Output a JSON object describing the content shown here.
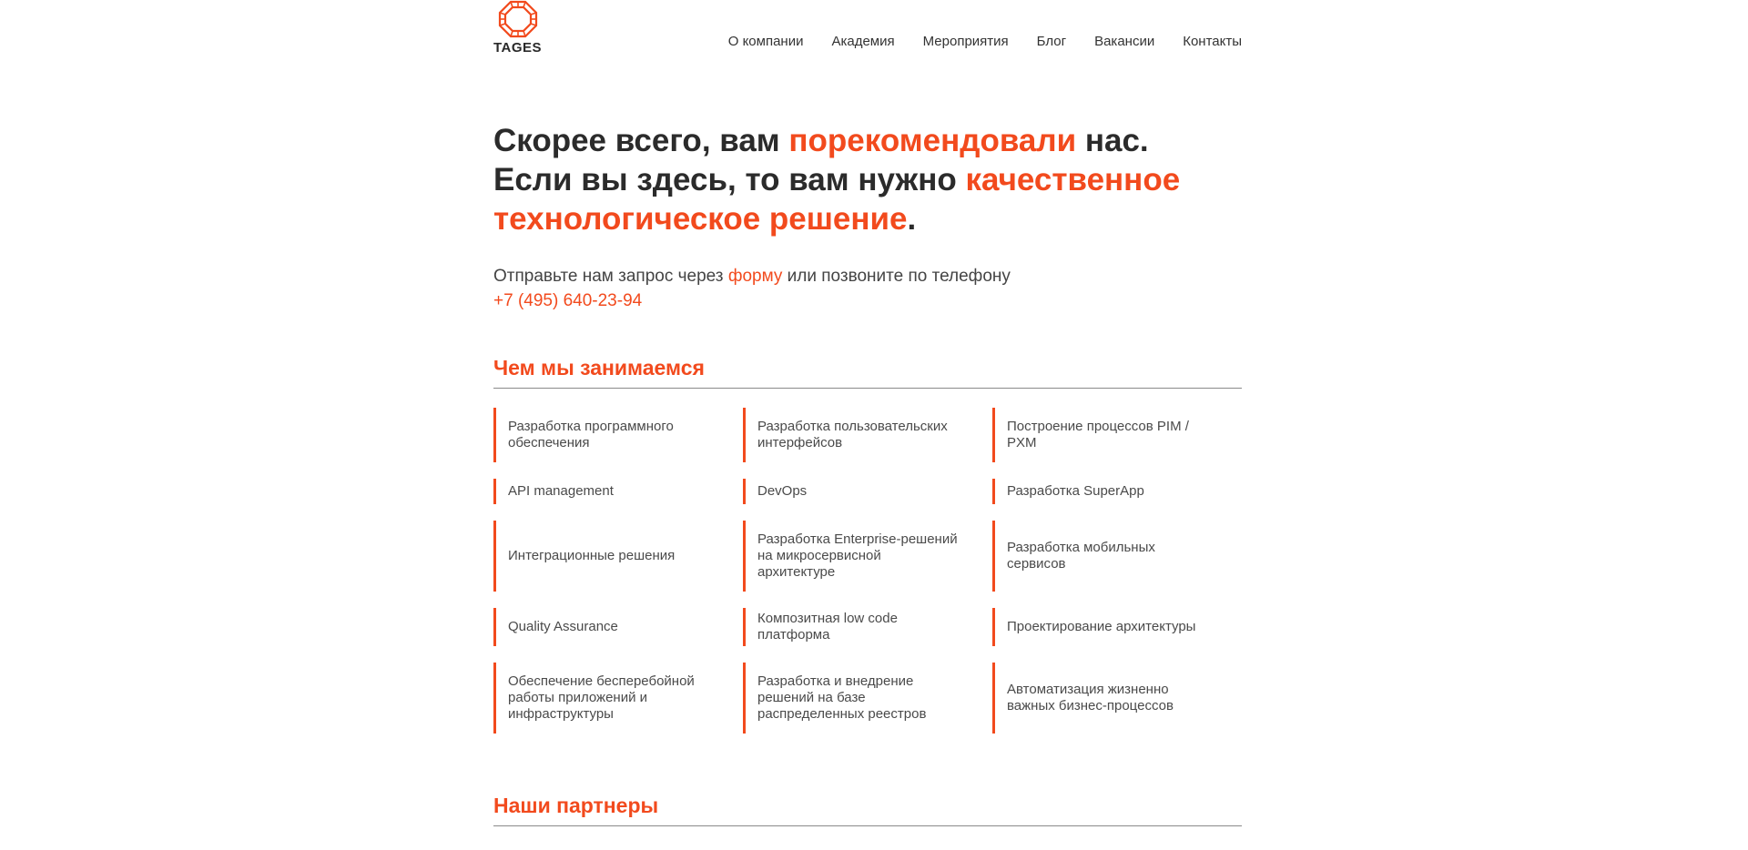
{
  "header": {
    "logo_text": "TAGES",
    "nav": [
      "О компании",
      "Академия",
      "Мероприятия",
      "Блог",
      "Вакансии",
      "Контакты"
    ]
  },
  "hero": {
    "line1_a": "Скорее всего, вам ",
    "line1_accent": "порекомендовали",
    "line1_b": " нас.",
    "line2_a": "Если вы здесь, то вам нужно ",
    "line2_accent": "качественное технологическое решение",
    "line2_b": "."
  },
  "lead": {
    "text_a": "Отправьте нам запрос через ",
    "form_link": "форму",
    "text_b": " или позвоните по телефону",
    "phone": "+7 (495) 640-23-94"
  },
  "services": {
    "title": "Чем мы занимаемся",
    "rows": [
      [
        "Разработка программного обеспечения",
        "Разработка пользовательских интерфейсов",
        "Построение процессов PIM / PXM"
      ],
      [
        "API management",
        "DevOps",
        "Разработка SuperApp"
      ],
      [
        "Интеграционные решения",
        "Разработка Enterprise-решений на микросервисной архитектуре",
        "Разработка мобильных сервисов"
      ],
      [
        "Quality Assurance",
        "Композитная low code платформа",
        "Проектирование архитектуры"
      ],
      [
        "Обеспечение бесперебойной работы приложений и инфраструктуры",
        "Разработка и внедрение решений на базе распределенных реестров",
        "Автоматизация жизненно важных бизнес-процессов"
      ]
    ]
  },
  "partners": {
    "title": "Наши партнеры"
  },
  "colors": {
    "accent": "#f24a1d",
    "text": "#333333",
    "rule": "#8a8a8a"
  }
}
